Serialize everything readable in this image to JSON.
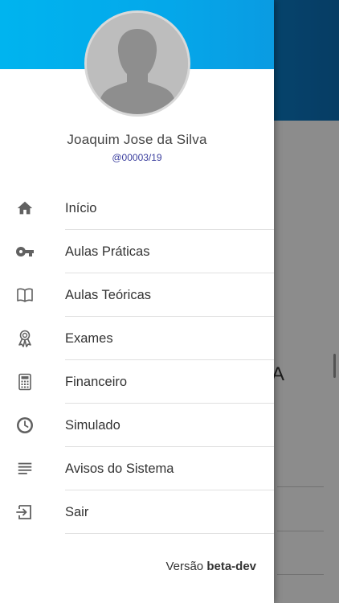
{
  "user": {
    "name": "Joaquim Jose da Silva",
    "handle": "@00003/19"
  },
  "menu": {
    "items": [
      {
        "label": "Início",
        "icon": "home-icon"
      },
      {
        "label": "Aulas Práticas",
        "icon": "key-icon"
      },
      {
        "label": "Aulas Teóricas",
        "icon": "book-icon"
      },
      {
        "label": "Exames",
        "icon": "award-icon"
      },
      {
        "label": "Financeiro",
        "icon": "calculator-icon"
      },
      {
        "label": "Simulado",
        "icon": "clock-icon"
      },
      {
        "label": "Avisos do Sistema",
        "icon": "notes-icon"
      },
      {
        "label": "Sair",
        "icon": "logout-icon"
      }
    ]
  },
  "footer": {
    "version_prefix": "Versão",
    "version_value": "beta-dev"
  },
  "background": {
    "fragment_text": "A"
  },
  "colors": {
    "header_gradient_start": "#00b4ef",
    "header_gradient_end": "#0c6fb7",
    "handle_text": "#3b3f9e",
    "icon": "#616161"
  }
}
